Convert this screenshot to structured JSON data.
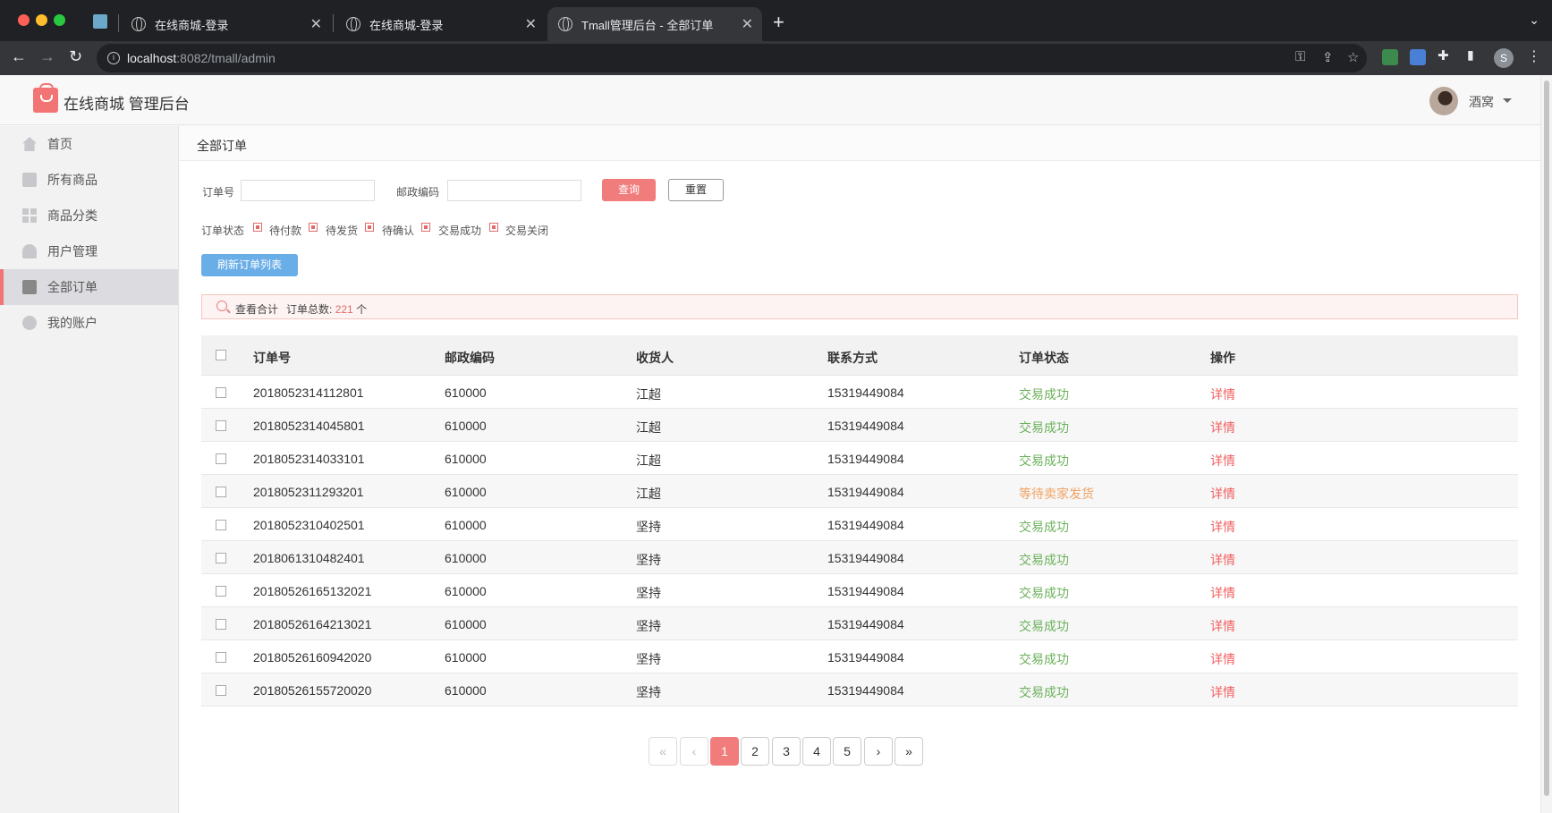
{
  "browser": {
    "tabs": [
      {
        "title": "在线商城-登录"
      },
      {
        "title": "在线商城-登录"
      },
      {
        "title": "Tmall管理后台 - 全部订单"
      }
    ],
    "url_host": "localhost",
    "url_rest": ":8082/tmall/admin"
  },
  "header": {
    "brand": "在线商城 管理后台",
    "user_name": "酒窝"
  },
  "sidebar": {
    "items": [
      {
        "label": "首页",
        "icon": "home-icon"
      },
      {
        "label": "所有商品",
        "icon": "product-icon"
      },
      {
        "label": "商品分类",
        "icon": "category-icon"
      },
      {
        "label": "用户管理",
        "icon": "user-icon"
      },
      {
        "label": "全部订单",
        "icon": "order-icon",
        "active": true
      },
      {
        "label": "我的账户",
        "icon": "gear-icon"
      }
    ]
  },
  "main": {
    "title": "全部订单",
    "filters": {
      "order_no_label": "订单号",
      "order_no_value": "",
      "postcode_label": "邮政编码",
      "postcode_value": "",
      "query_button": "查询",
      "reset_button": "重置",
      "status_label": "订单状态",
      "status_options": [
        "待付款",
        "待发货",
        "待确认",
        "交易成功",
        "交易关闭"
      ]
    },
    "refresh_button": "刷新订单列表",
    "summary": {
      "view_total": "查看合计",
      "count_prefix": "订单总数:",
      "count": "221",
      "count_suffix": "个"
    },
    "table": {
      "headers": [
        "订单号",
        "邮政编码",
        "收货人",
        "联系方式",
        "订单状态",
        "操作"
      ],
      "rows": [
        {
          "order_no": "2018052314112801",
          "postcode": "610000",
          "receiver": "江超",
          "contact": "15319449084",
          "status": "交易成功",
          "action": "详情"
        },
        {
          "order_no": "2018052314045801",
          "postcode": "610000",
          "receiver": "江超",
          "contact": "15319449084",
          "status": "交易成功",
          "action": "详情"
        },
        {
          "order_no": "2018052314033101",
          "postcode": "610000",
          "receiver": "江超",
          "contact": "15319449084",
          "status": "交易成功",
          "action": "详情"
        },
        {
          "order_no": "2018052311293201",
          "postcode": "610000",
          "receiver": "江超",
          "contact": "15319449084",
          "status": "等待卖家发货",
          "action": "详情"
        },
        {
          "order_no": "2018052310402501",
          "postcode": "610000",
          "receiver": "坚持",
          "contact": "15319449084",
          "status": "交易成功",
          "action": "详情"
        },
        {
          "order_no": "2018061310482401",
          "postcode": "610000",
          "receiver": "坚持",
          "contact": "15319449084",
          "status": "交易成功",
          "action": "详情"
        },
        {
          "order_no": "20180526165132021",
          "postcode": "610000",
          "receiver": "坚持",
          "contact": "15319449084",
          "status": "交易成功",
          "action": "详情"
        },
        {
          "order_no": "20180526164213021",
          "postcode": "610000",
          "receiver": "坚持",
          "contact": "15319449084",
          "status": "交易成功",
          "action": "详情"
        },
        {
          "order_no": "20180526160942020",
          "postcode": "610000",
          "receiver": "坚持",
          "contact": "15319449084",
          "status": "交易成功",
          "action": "详情"
        },
        {
          "order_no": "20180526155720020",
          "postcode": "610000",
          "receiver": "坚持",
          "contact": "15319449084",
          "status": "交易成功",
          "action": "详情"
        }
      ]
    },
    "pagination": {
      "first": "«",
      "prev": "‹",
      "pages": [
        "1",
        "2",
        "3",
        "4",
        "5"
      ],
      "current": "1",
      "next": "›",
      "last": "»"
    }
  },
  "colors": {
    "accent": "#f07c7c",
    "success": "#6bb15b",
    "waiting": "#f0a262",
    "refresh": "#6aaee8"
  }
}
